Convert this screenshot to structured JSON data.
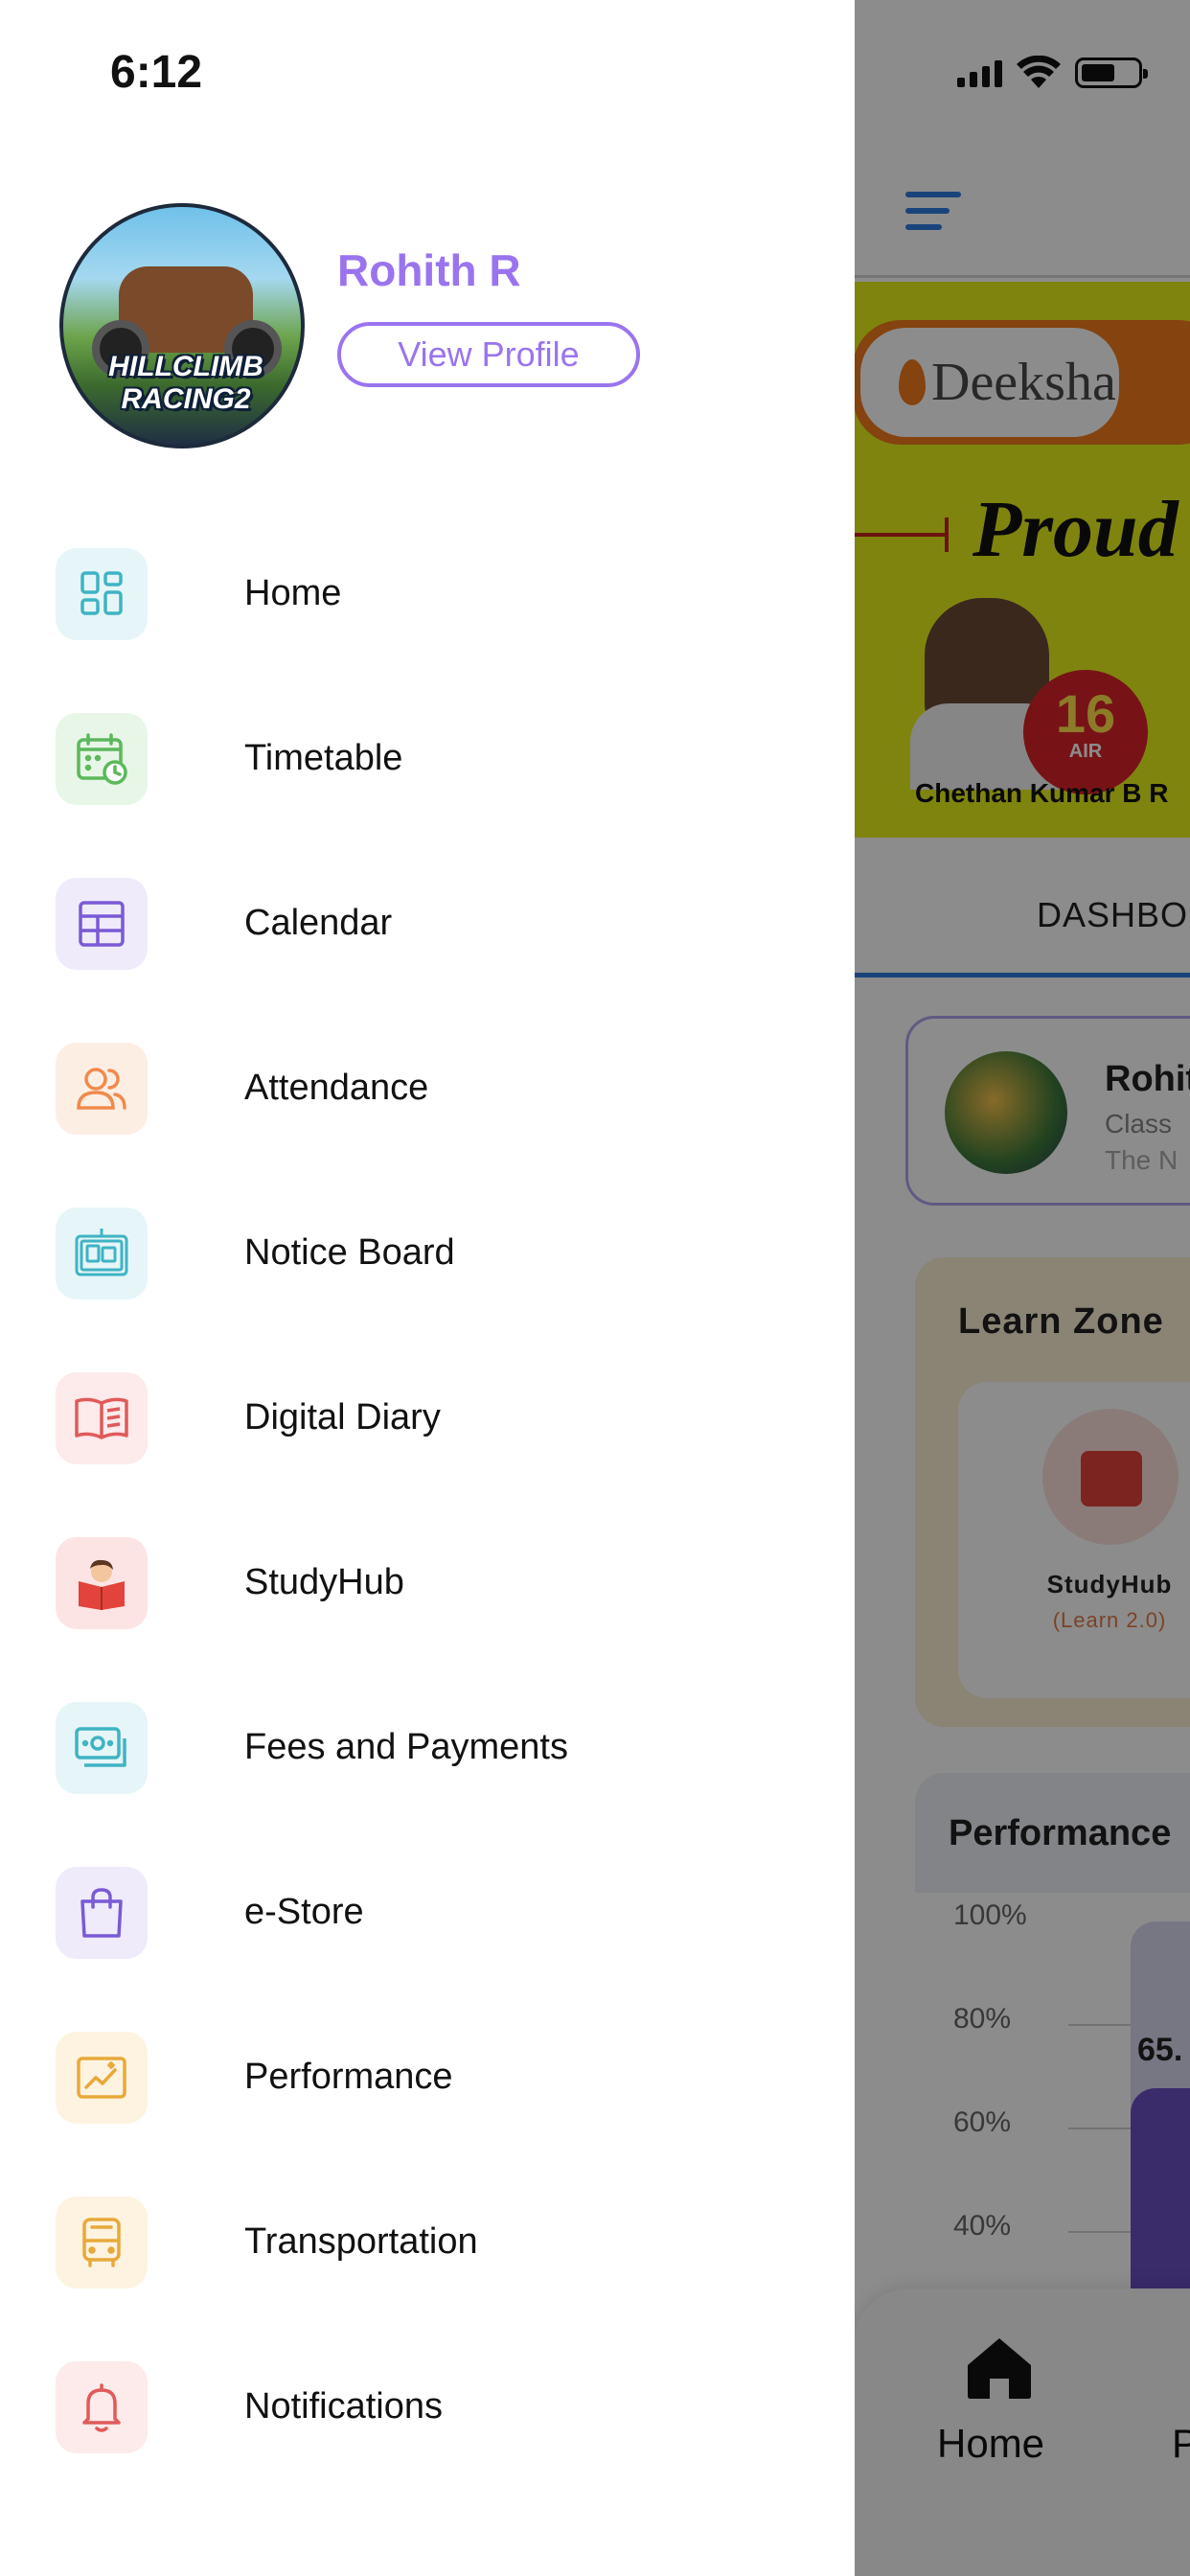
{
  "status_bar": {
    "time": "6:12"
  },
  "drawer": {
    "user": {
      "name": "Rohith R",
      "avatar_text": "HILLCLIMB RACING2",
      "view_profile_label": "View Profile"
    },
    "menu": [
      {
        "label": "Home",
        "icon": "dashboard-icon",
        "bg": "#e6f6f8",
        "fg": "#3fb3c4"
      },
      {
        "label": "Timetable",
        "icon": "calendar-clock-icon",
        "bg": "#e8f6e8",
        "fg": "#5cb85c"
      },
      {
        "label": "Calendar",
        "icon": "grid-calendar-icon",
        "bg": "#efebfb",
        "fg": "#7a5ad6"
      },
      {
        "label": "Attendance",
        "icon": "users-icon",
        "bg": "#fdeee4",
        "fg": "#f08a4b"
      },
      {
        "label": "Notice Board",
        "icon": "notice-board-icon",
        "bg": "#e6f6f8",
        "fg": "#3fb3c4"
      },
      {
        "label": "Digital Diary",
        "icon": "book-open-icon",
        "bg": "#fdeaea",
        "fg": "#e05a5a"
      },
      {
        "label": "StudyHub",
        "icon": "studyhub-icon",
        "bg": "#fde4e4",
        "fg": "#e2433a"
      },
      {
        "label": "Fees and Payments",
        "icon": "money-icon",
        "bg": "#e6f6f8",
        "fg": "#3fb3c4"
      },
      {
        "label": "e-Store",
        "icon": "shopping-bag-icon",
        "bg": "#efebfb",
        "fg": "#7a5ad6"
      },
      {
        "label": "Performance",
        "icon": "chart-image-icon",
        "bg": "#fdf3e0",
        "fg": "#e8a93a"
      },
      {
        "label": "Transportation",
        "icon": "bus-icon",
        "bg": "#fdf3e0",
        "fg": "#e8a93a"
      },
      {
        "label": "Notifications",
        "icon": "bell-icon",
        "bg": "#fdeaea",
        "fg": "#e05a5a"
      }
    ]
  },
  "background_app": {
    "banner": {
      "brand": "Deeksha",
      "headline": "Proud o",
      "rank": "16",
      "rank_sub": "AIR",
      "student": "Chethan Kumar B R"
    },
    "tab": "DASHBO",
    "profile_card": {
      "name": "Rohit",
      "class": "Class",
      "school": "The N"
    },
    "learn_zone": {
      "title": "Learn Zone",
      "item_name": "StudyHub",
      "item_sub": "(Learn 2.0)"
    },
    "performance": {
      "title": "Performance",
      "chart_data": {
        "type": "bar",
        "title": "Performance",
        "yticks": [
          "100%",
          "80%",
          "60%",
          "40%"
        ],
        "ylim": [
          40,
          100
        ],
        "categories": [
          ""
        ],
        "values": [
          65
        ],
        "value_label": "65."
      }
    },
    "bottom_nav": {
      "home_label": "Home",
      "next_label": "P"
    }
  }
}
